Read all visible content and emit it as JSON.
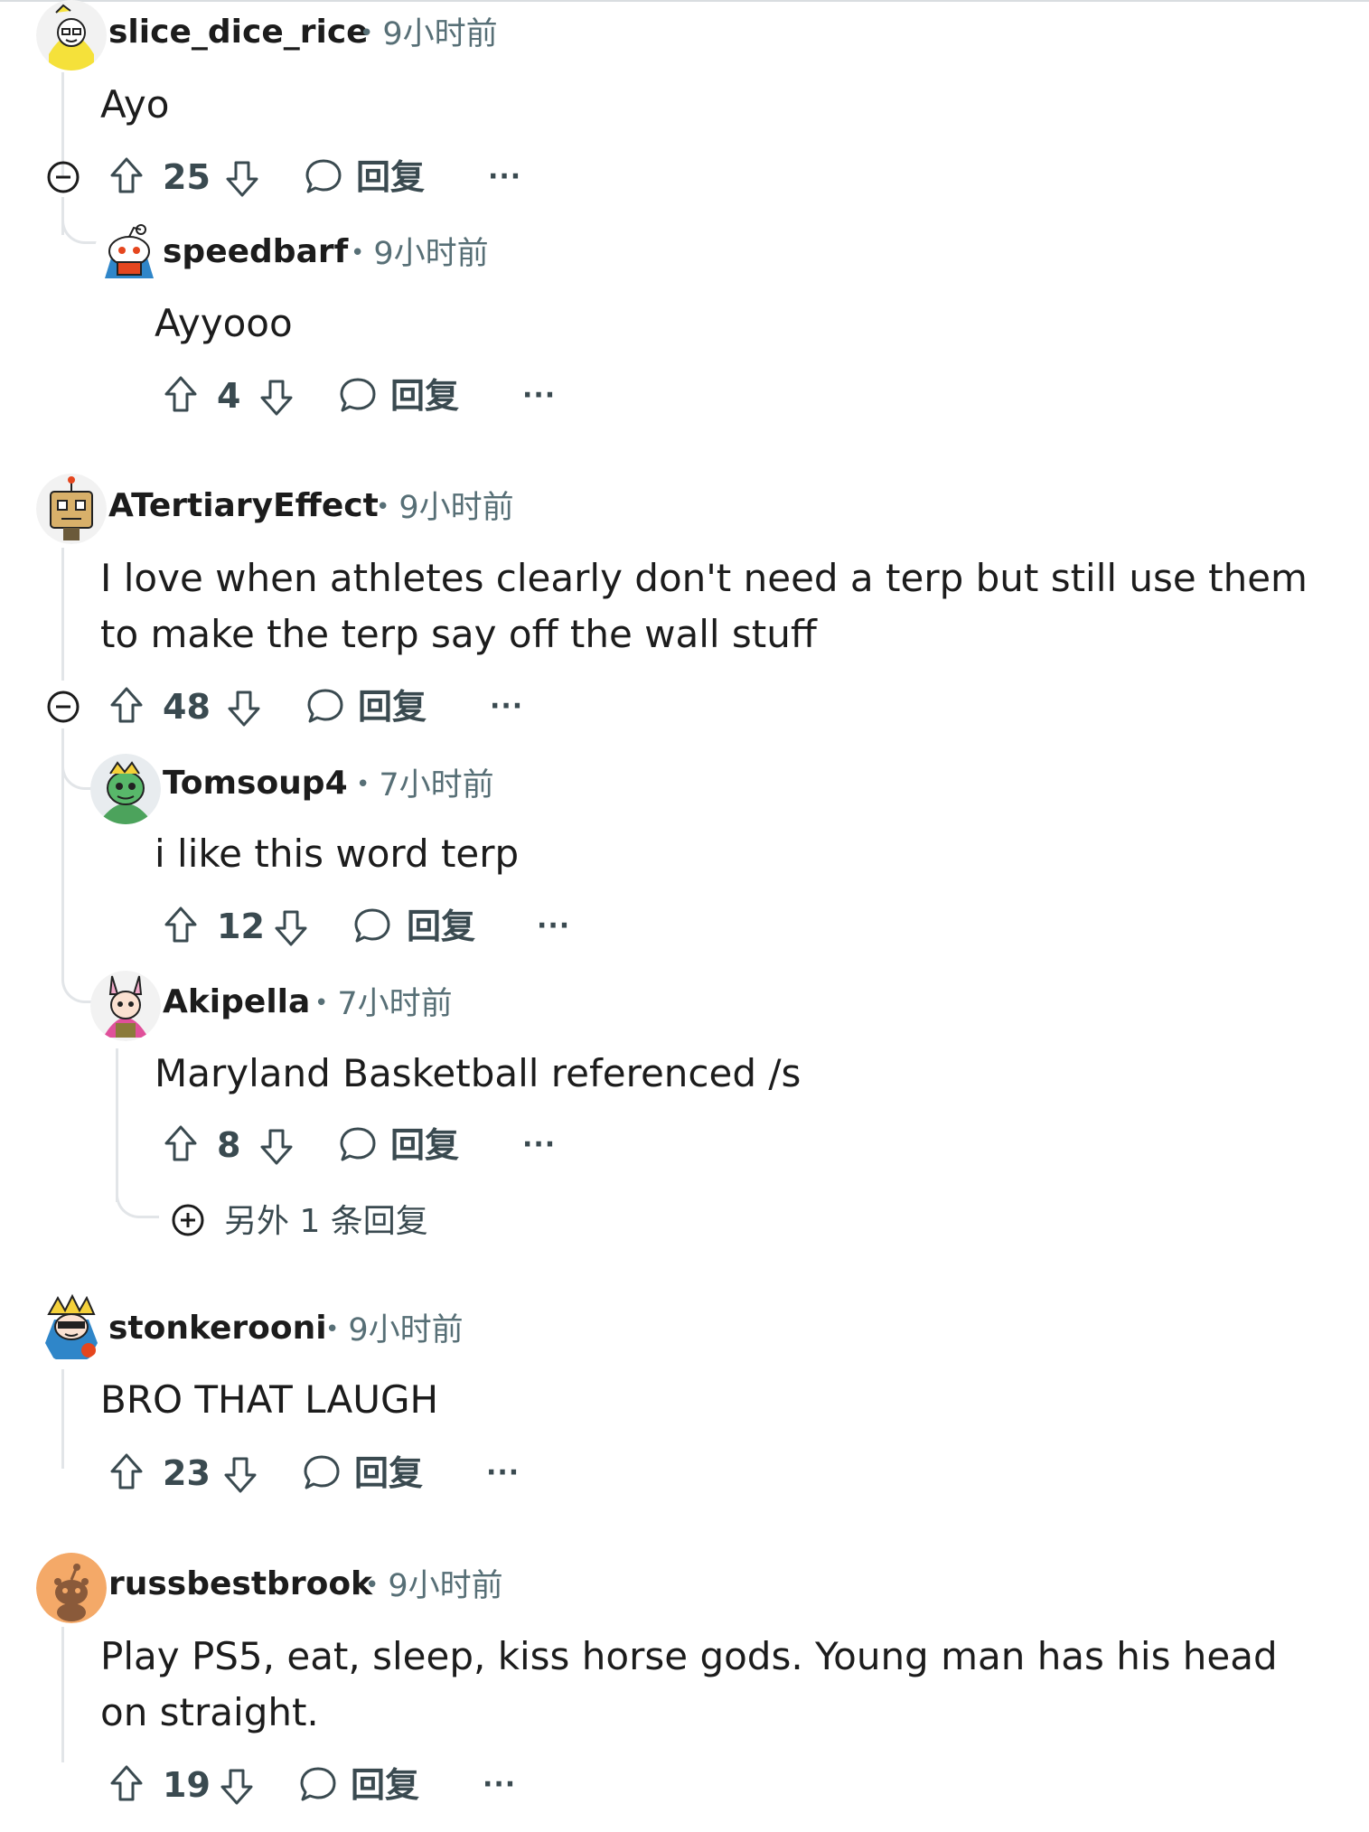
{
  "comments": [
    {
      "username": "slice_dice_rice",
      "time": "9小时前",
      "body": "Ayo",
      "score": "25",
      "reply_label": "回复",
      "more_label": "···",
      "replies": [
        {
          "username": "speedbarf",
          "time": "9小时前",
          "body": "Ayyooo",
          "score": "4",
          "reply_label": "回复",
          "more_label": "···"
        }
      ]
    },
    {
      "username": "ATertiaryEffect",
      "time": "9小时前",
      "body": "I love when athletes clearly don't need a terp but still use them to make the terp say off the wall stuff",
      "score": "48",
      "reply_label": "回复",
      "more_label": "···",
      "replies": [
        {
          "username": "Tomsoup4",
          "time": "7小时前",
          "body": "i like this word terp",
          "score": "12",
          "reply_label": "回复",
          "more_label": "···"
        },
        {
          "username": "Akipella",
          "time": "7小时前",
          "body": "Maryland Basketball referenced /s",
          "score": "8",
          "reply_label": "回复",
          "more_label": "···"
        }
      ],
      "more_replies": "另外 1 条回复"
    },
    {
      "username": "stonkerooni",
      "time": "9小时前",
      "body": "BRO THAT LAUGH",
      "score": "23",
      "reply_label": "回复",
      "more_label": "···"
    },
    {
      "username": "russbestbrook",
      "time": "9小时前",
      "body": "Play PS5, eat, sleep, kiss horse gods. Young man has his head on straight.",
      "score": "19",
      "reply_label": "回复",
      "more_label": "···"
    }
  ],
  "icons": {
    "collapse": "collapse-icon",
    "expand": "expand-icon",
    "upvote": "upvote-icon",
    "downvote": "downvote-icon",
    "reply": "reply-bubble-icon"
  },
  "colors": {
    "text": "#1c1c1c",
    "muted": "#576f76",
    "action": "#3a4a50",
    "thread_line": "#e2e5e8"
  }
}
